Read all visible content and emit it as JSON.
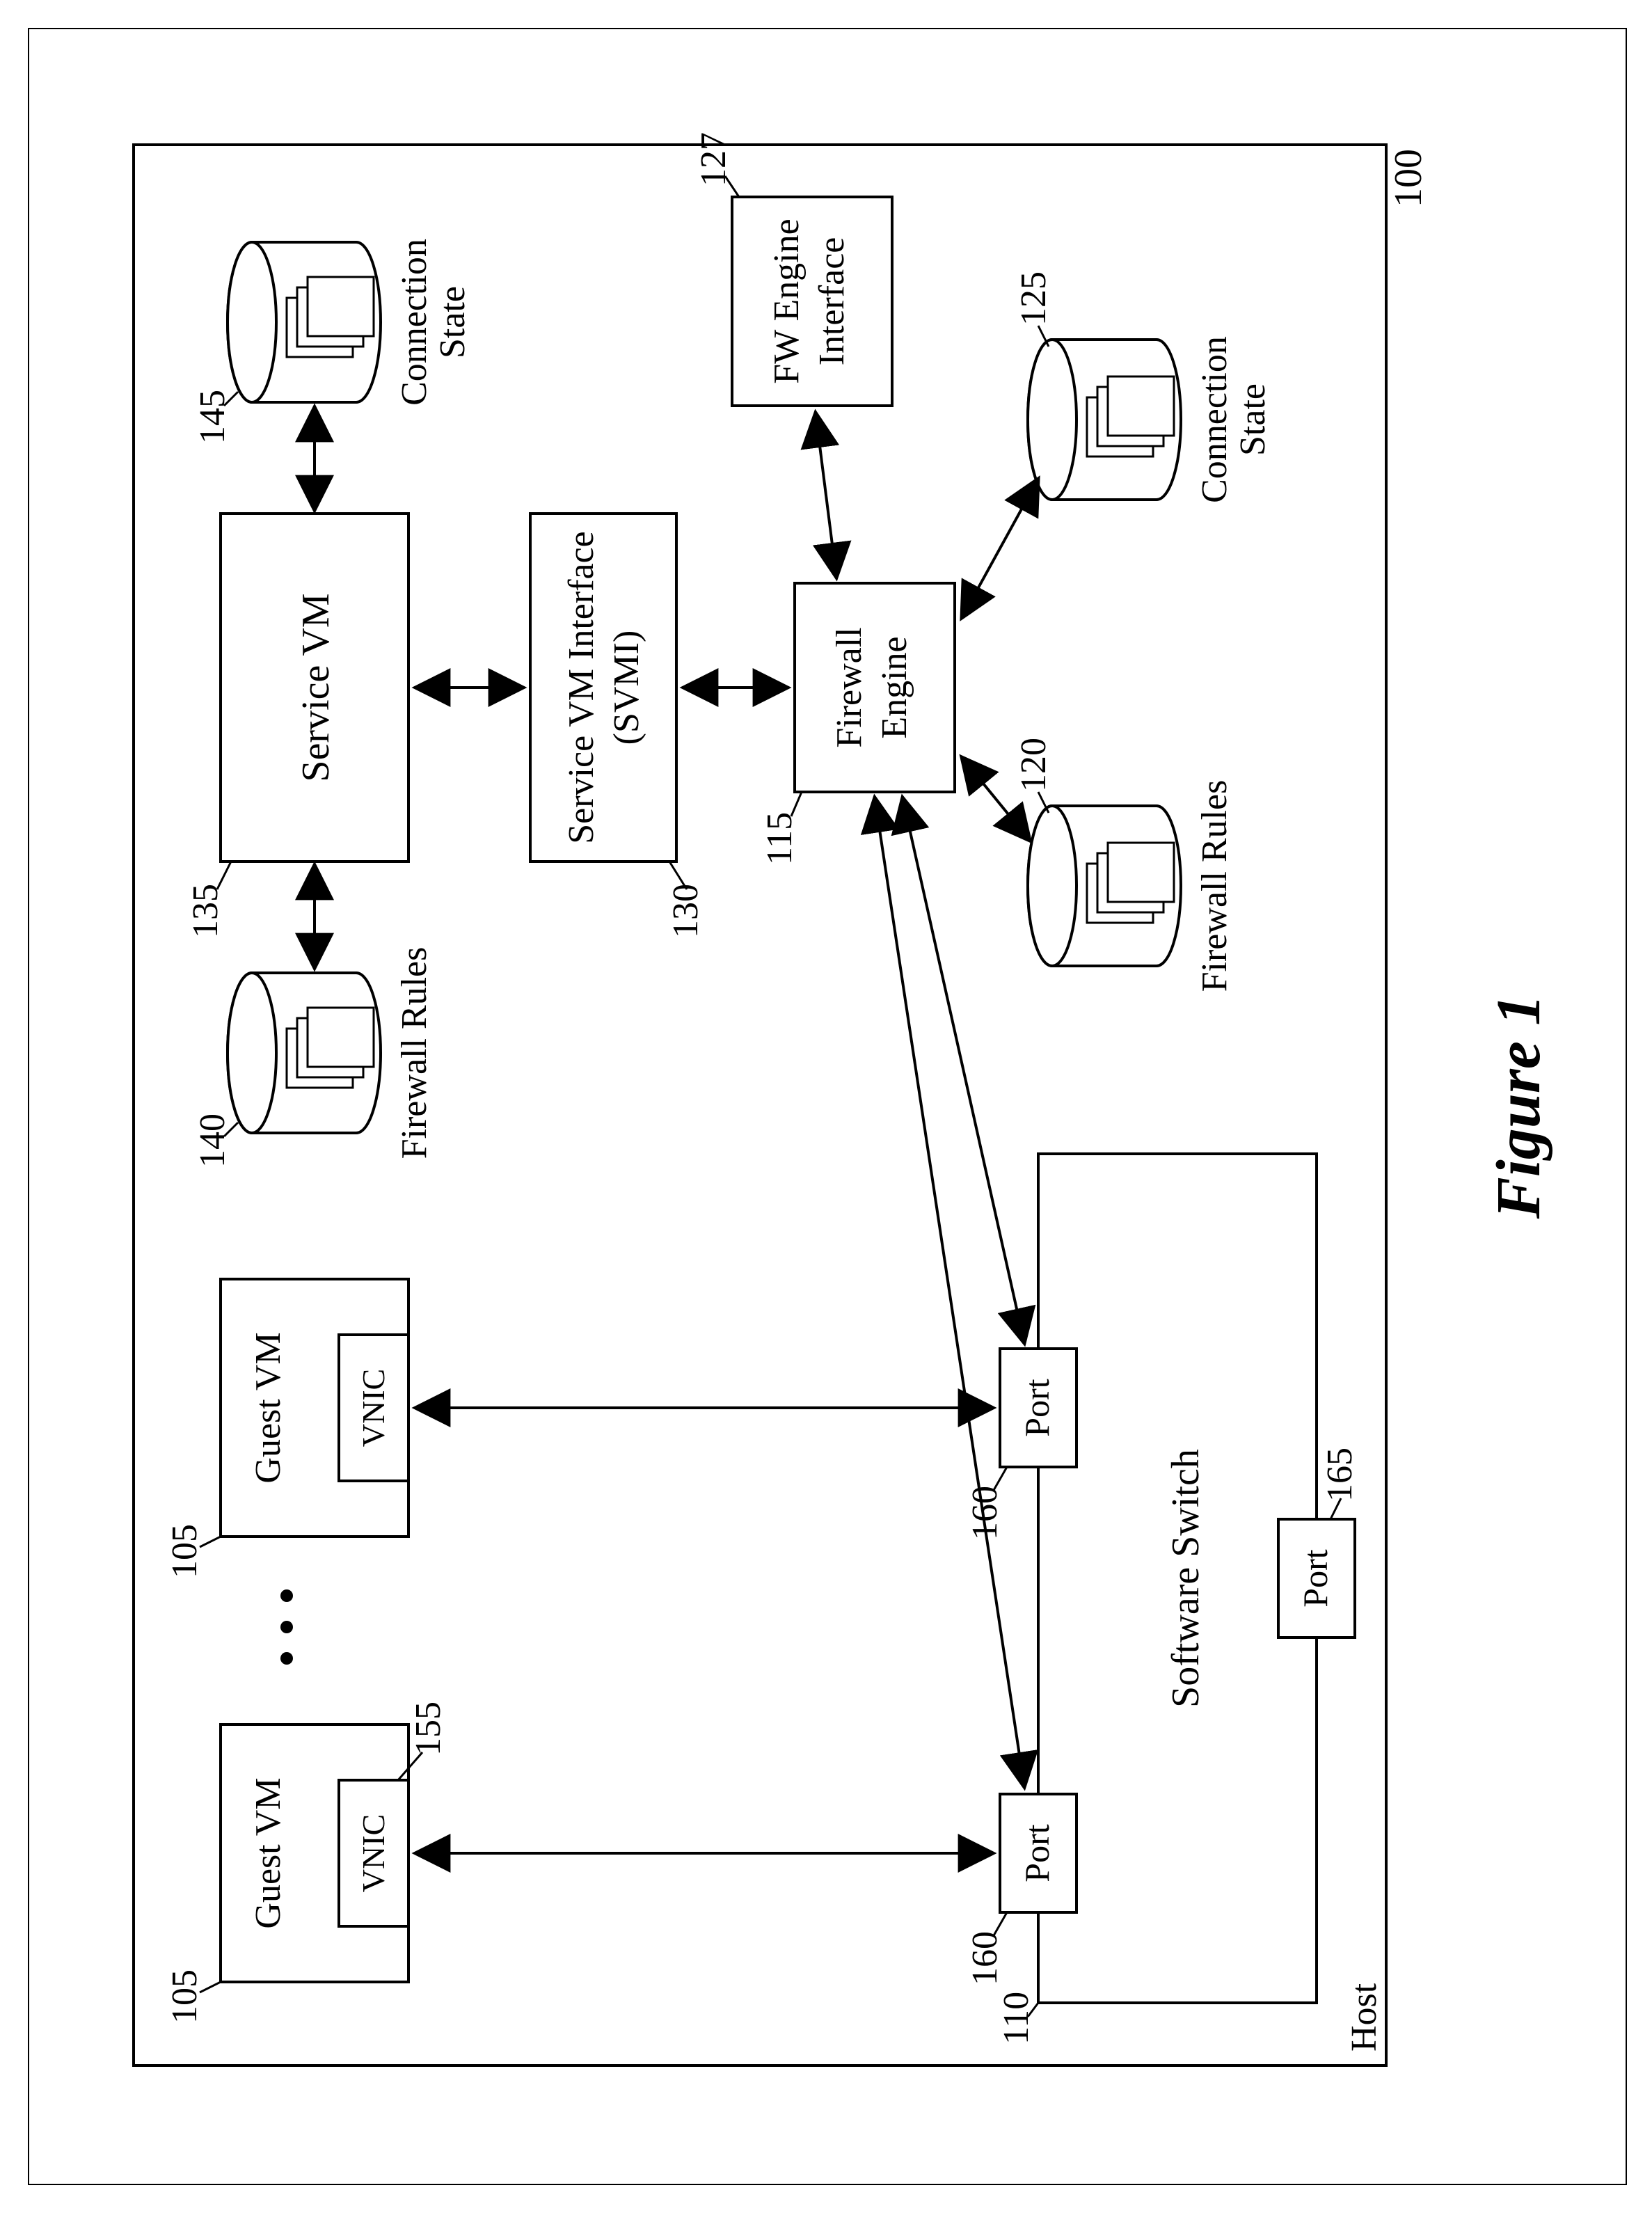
{
  "figure_caption": "Figure 1",
  "host_label": "Host",
  "boxes": {
    "guest_vm_1": {
      "label": "Guest VM",
      "ref": "105",
      "sub": {
        "label": "VNIC",
        "ref": "155"
      }
    },
    "guest_vm_2": {
      "label": "Guest VM",
      "ref": "105",
      "sub": {
        "label": "VNIC"
      }
    },
    "service_vm": {
      "label": "Service VM",
      "ref": "135"
    },
    "svmi": {
      "label1": "Service VM Interface",
      "label2": "(SVMI)",
      "ref": "130"
    },
    "firewall_engine": {
      "label1": "Firewall",
      "label2": "Engine",
      "ref": "115"
    },
    "fw_engine_interface": {
      "label1": "FW Engine",
      "label2": "Interface",
      "ref": "127"
    },
    "software_switch": {
      "label": "Software Switch",
      "ref": "110"
    },
    "port_top_1": {
      "label": "Port",
      "ref": "160"
    },
    "port_top_2": {
      "label": "Port",
      "ref": "160"
    },
    "port_bottom": {
      "label": "Port",
      "ref": "165"
    }
  },
  "cylinders": {
    "fw_rules_top": {
      "label": "Firewall Rules",
      "ref": "140"
    },
    "conn_state_top": {
      "label1": "Connection",
      "label2": "State",
      "ref": "145"
    },
    "fw_rules_bottom": {
      "label": "Firewall Rules",
      "ref": "120"
    },
    "conn_state_bottom": {
      "label1": "Connection",
      "label2": "State",
      "ref": "125"
    }
  },
  "ref_100": "100"
}
